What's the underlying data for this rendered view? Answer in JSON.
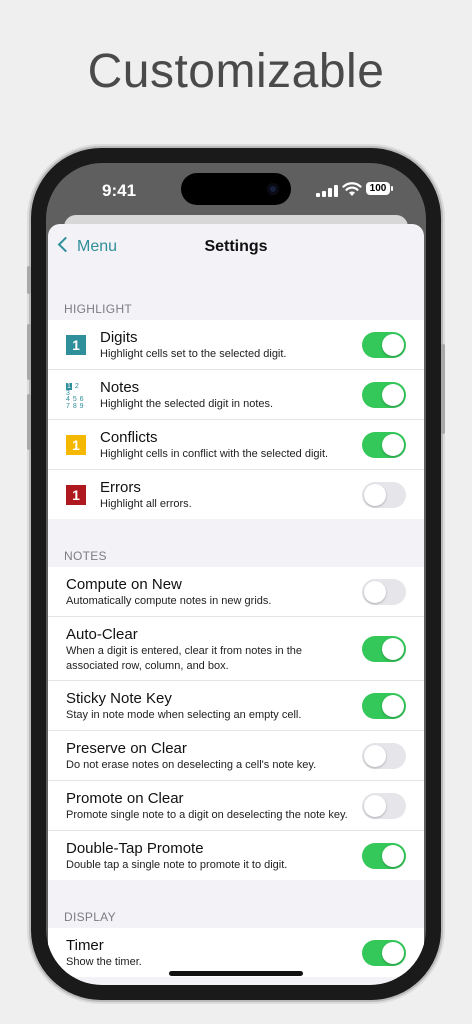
{
  "headline": "Customizable",
  "status": {
    "time": "9:41",
    "battery": "100"
  },
  "nav": {
    "back_label": "Menu",
    "title": "Settings"
  },
  "colors": {
    "accent": "#2f8f9a",
    "toggle_on": "#34c759",
    "conflict": "#f5b800",
    "error": "#b0181f",
    "digit": "#2f8f9a"
  },
  "sections": {
    "highlight": {
      "header": "HIGHLIGHT",
      "rows": [
        {
          "icon": "digit-cell-icon",
          "icon_text": "1",
          "label": "Digits",
          "subtitle": "Highlight cells set to the selected digit.",
          "on": true
        },
        {
          "icon": "notes-grid-icon",
          "icon_text": "1 2 3 / 4 5 6 / 7 8 9",
          "label": "Notes",
          "subtitle": "Highlight the selected digit in notes.",
          "on": true
        },
        {
          "icon": "conflict-cell-icon",
          "icon_text": "1",
          "label": "Conflicts",
          "subtitle": "Highlight cells in conflict with the selected digit.",
          "on": true
        },
        {
          "icon": "error-cell-icon",
          "icon_text": "1",
          "label": "Errors",
          "subtitle": "Highlight all errors.",
          "on": false
        }
      ]
    },
    "notes": {
      "header": "NOTES",
      "rows": [
        {
          "label": "Compute on New",
          "subtitle": "Automatically compute notes in new grids.",
          "on": false
        },
        {
          "label": "Auto-Clear",
          "subtitle": "When a digit is entered, clear it from notes in the associated row, column, and box.",
          "on": true
        },
        {
          "label": "Sticky Note Key",
          "subtitle": "Stay in note mode when selecting an empty cell.",
          "on": true
        },
        {
          "label": "Preserve on Clear",
          "subtitle": "Do not erase notes on deselecting a cell's note key.",
          "on": false
        },
        {
          "label": "Promote on Clear",
          "subtitle": "Promote single note to a digit on deselecting the note key.",
          "on": false
        },
        {
          "label": "Double-Tap Promote",
          "subtitle": "Double tap a single note to promote it to digit.",
          "on": true
        }
      ]
    },
    "display": {
      "header": "DISPLAY",
      "rows": [
        {
          "label": "Timer",
          "subtitle": "Show the timer.",
          "on": true
        }
      ]
    }
  }
}
